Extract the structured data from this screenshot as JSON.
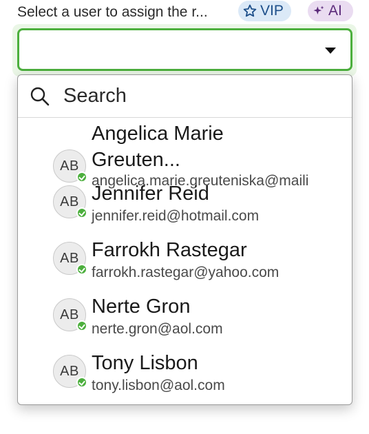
{
  "field": {
    "label": "Select a user to assign the r...",
    "value": ""
  },
  "badges": {
    "vip": {
      "label": "VIP",
      "icon": "star-icon"
    },
    "ai": {
      "label": "AI",
      "icon": "sparkle-icon"
    }
  },
  "search": {
    "placeholder": "Search",
    "icon": "search-icon"
  },
  "options": [
    {
      "initials": "AB",
      "name": "Angelica Marie Greuten...",
      "email": "angelica.marie.greuteniska@maili",
      "status": "online"
    },
    {
      "initials": "AB",
      "name": "Jennifer Reid",
      "email": "jennifer.reid@hotmail.com",
      "status": "online"
    },
    {
      "initials": "AB",
      "name": "Farrokh Rastegar",
      "email": "farrokh.rastegar@yahoo.com",
      "status": "online"
    },
    {
      "initials": "AB",
      "name": "Nerte Gron",
      "email": "nerte.gron@aol.com",
      "status": "online"
    },
    {
      "initials": "AB",
      "name": "Tony Lisbon",
      "email": "tony.lisbon@aol.com",
      "status": "online"
    }
  ],
  "colors": {
    "focus_border": "#4caf3d",
    "presence_online": "#4caf3d",
    "vip_badge_bg": "#dbe9f7",
    "ai_badge_bg": "#eadcf1"
  }
}
